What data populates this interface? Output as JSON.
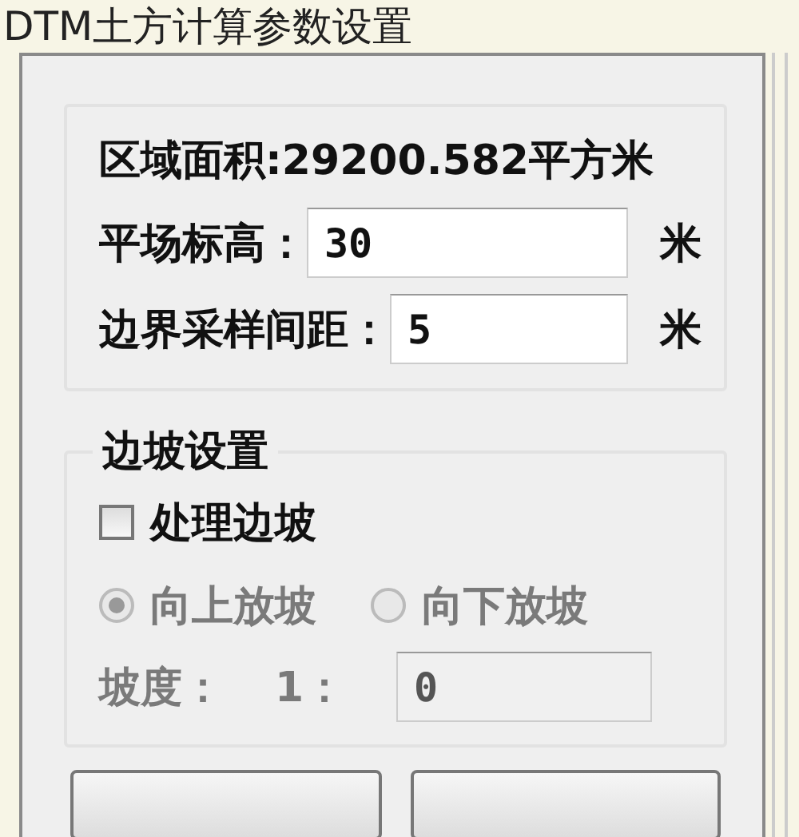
{
  "window": {
    "title": "DTM土方计算参数设置"
  },
  "area_label": "区域面积:29200.582平方米",
  "fields": [
    {
      "label": "平场标高：",
      "value": "30",
      "unit": "米"
    },
    {
      "label": "边界采样间距：",
      "value": "5",
      "unit": "米"
    }
  ],
  "slope_group": {
    "title": "边坡设置",
    "checkbox": {
      "label": "处理边坡",
      "checked": false
    },
    "radios": [
      {
        "label": "向上放坡",
        "selected": true,
        "disabled": true
      },
      {
        "label": "向下放坡",
        "selected": false,
        "disabled": true
      }
    ],
    "slope": {
      "label": "坡度：",
      "ratio": "1：",
      "value": "0",
      "disabled": true
    }
  }
}
